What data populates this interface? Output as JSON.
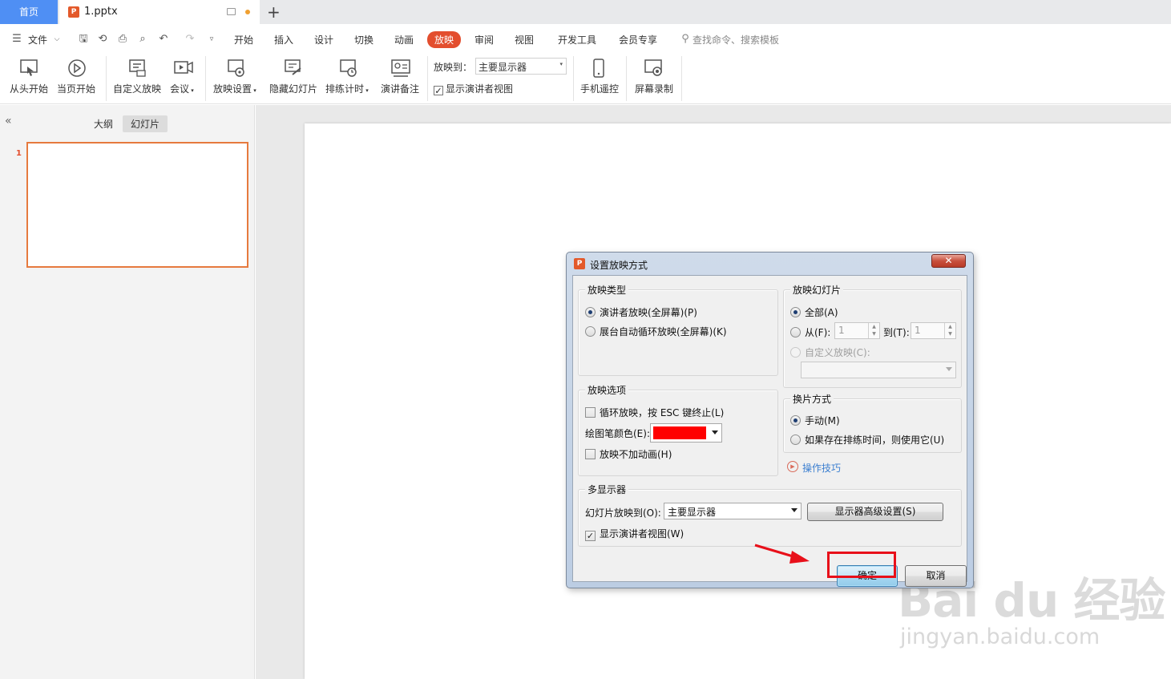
{
  "tabs": {
    "home": "首页",
    "doc": "1.pptx",
    "new": "+"
  },
  "menu": {
    "file": "文件",
    "items": [
      "开始",
      "插入",
      "设计",
      "切换",
      "动画",
      "放映",
      "审阅",
      "视图",
      "开发工具",
      "会员专享"
    ],
    "active": "放映",
    "search": "查找命令、搜索模板"
  },
  "ribbon": {
    "from_start": "从头开始",
    "from_current": "当页开始",
    "custom_show": "自定义放映",
    "meeting": "会议",
    "show_settings": "放映设置",
    "hide_slide": "隐藏幻灯片",
    "rehearse": "排练计时",
    "speaker_notes": "演讲备注",
    "play_to_label": "放映到：",
    "play_to_value": "主要显示器",
    "presenter_view": "显示演讲者视图",
    "phone_remote": "手机遥控",
    "screen_record": "屏幕录制"
  },
  "left_panel": {
    "outline": "大纲",
    "slides": "幻灯片",
    "slide_number": "1"
  },
  "dialog": {
    "title": "设置放映方式",
    "show_type": {
      "title": "放映类型",
      "presenter": "演讲者放映(全屏幕)(P)",
      "kiosk": "展台自动循环放映(全屏幕)(K)"
    },
    "show_slides": {
      "title": "放映幻灯片",
      "all": "全部(A)",
      "from": "从(F):",
      "from_value": "1",
      "to": "到(T):",
      "to_value": "1",
      "custom": "自定义放映(C):"
    },
    "show_options": {
      "title": "放映选项",
      "loop": "循环放映，按 ESC 键终止(L)",
      "pen_color": "绘图笔颜色(E):",
      "pen_color_value": "#ff0000",
      "no_animation": "放映不加动画(H)"
    },
    "advance": {
      "title": "换片方式",
      "manual": "手动(M)",
      "timings": "如果存在排练时间，则使用它(U)"
    },
    "tips": "操作技巧",
    "multi_monitor": {
      "title": "多显示器",
      "play_to": "幻灯片放映到(O):",
      "play_to_value": "主要显示器",
      "advanced": "显示器高级设置(S)",
      "presenter_view": "显示演讲者视图(W)"
    },
    "ok": "确定",
    "cancel": "取消"
  },
  "watermark": {
    "brand": "Bai du 经验",
    "url": "jingyan.baidu.com"
  },
  "colors": {
    "accent": "#e34e2e",
    "home_tab": "#4f8ff4",
    "highlight": "#e8101a"
  }
}
